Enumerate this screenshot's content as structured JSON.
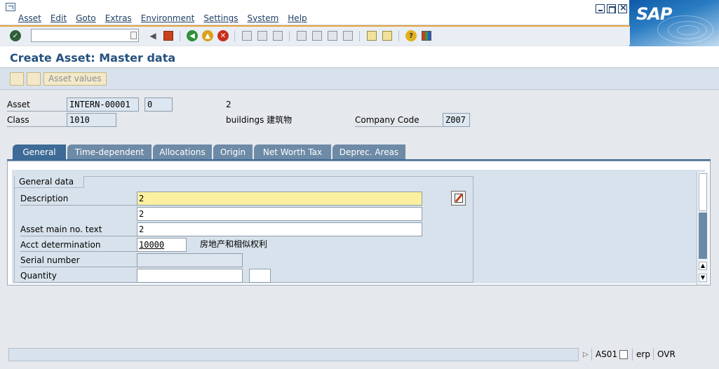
{
  "menu": [
    "Asset",
    "Edit",
    "Goto",
    "Extras",
    "Environment",
    "Settings",
    "System",
    "Help"
  ],
  "logo_text": "SAP",
  "command_field": {
    "value": ""
  },
  "title": "Create Asset:  Master data",
  "app_toolbar": {
    "asset_values_label": "Asset values"
  },
  "header": {
    "asset_label": "Asset",
    "asset_number": "INTERN-00001",
    "sub_number": "0",
    "asset_desc": "2",
    "class_label": "Class",
    "class_value": "1010",
    "class_desc": "buildings 建筑物",
    "company_code_label": "Company Code",
    "company_code_value": "Z007"
  },
  "tabs": [
    "General",
    "Time-dependent",
    "Allocations",
    "Origin",
    "Net Worth Tax",
    "Deprec. Areas"
  ],
  "active_tab": "General",
  "general_data": {
    "group_title": "General data",
    "description_label": "Description",
    "description_value": "2",
    "description2_value": "2",
    "asset_main_text_label": "Asset main no. text",
    "asset_main_text_value": "2",
    "acct_determination_label": "Acct determination",
    "acct_determination_value": "10000",
    "acct_determination_desc": "房地产和相似权利",
    "serial_number_label": "Serial number",
    "serial_number_value": "",
    "quantity_label": "Quantity",
    "quantity_value": "",
    "quantity_unit": ""
  },
  "status_bar": {
    "transaction": "AS01",
    "system": "erp",
    "mode": "OVR"
  },
  "colors": {
    "title": "#25517e",
    "tab_active": "#3d6a96",
    "tab_inactive": "#6d8aa6",
    "required_field": "#fbf0a0",
    "toolbar_accent": "#e6a33a"
  }
}
